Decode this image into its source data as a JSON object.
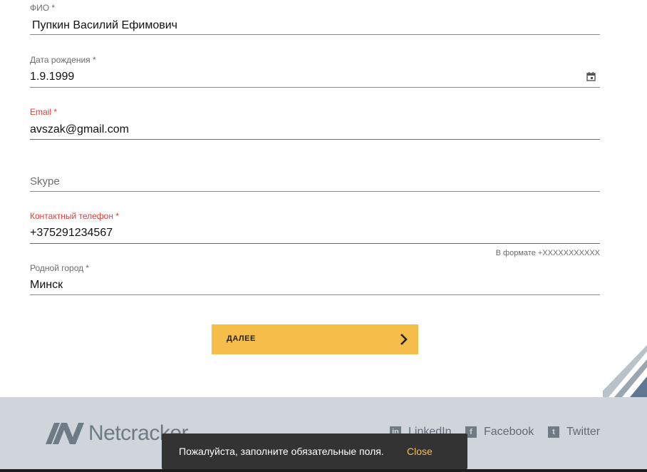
{
  "form": {
    "fields": [
      {
        "label": "ФИО *",
        "value": "Пупкин Василий Ефимович"
      },
      {
        "label": "Дата рождения *",
        "value": "1.9.1999",
        "icon": "calendar-icon"
      },
      {
        "label": "Email *",
        "value": "avszak@gmail.com",
        "error": true
      },
      {
        "label": "",
        "placeholder": "Skype",
        "value": ""
      },
      {
        "label": "Контактный телефон *",
        "value": "+375291234567",
        "hint": "В формате +XXXXXXXXXXX",
        "error": true
      },
      {
        "label": "Родной город *",
        "value": "Минск"
      }
    ],
    "next_label": "ДАЛЕЕ",
    "error_color": "#e53935"
  },
  "footer": {
    "brand": "Netcracker",
    "social": [
      {
        "label": "LinkedIn",
        "icon": "linkedin-icon",
        "glyph": "in"
      },
      {
        "label": "Facebook",
        "icon": "facebook-icon",
        "glyph": "f"
      },
      {
        "label": "Twitter",
        "icon": "twitter-icon",
        "glyph": "t"
      }
    ]
  },
  "toast": {
    "message": "Пожалуйста, заполните обязательные поля.",
    "action": "Close",
    "action_color": "#f5be4b"
  },
  "colors": {
    "accent": "#f5be4b",
    "footer_bg": "#cfd5da",
    "toast_bg": "#333333"
  }
}
